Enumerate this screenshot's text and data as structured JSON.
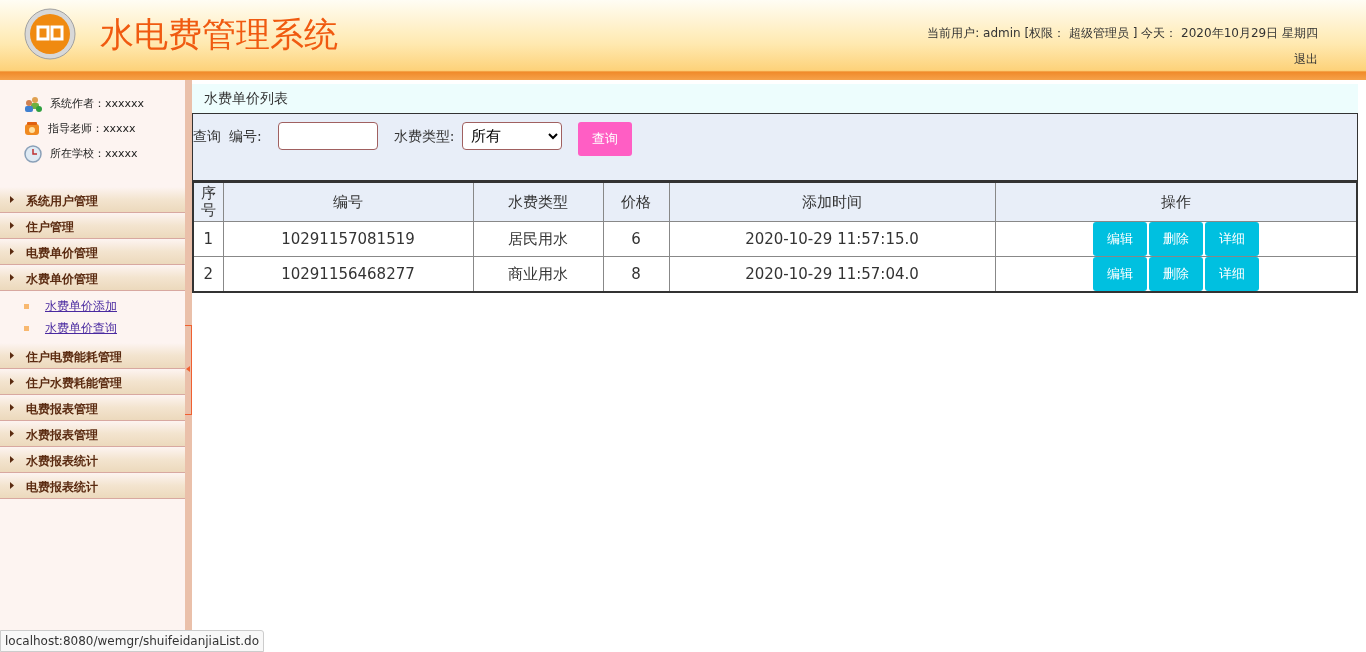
{
  "header": {
    "title": "水电费管理系统",
    "user_info": "当前用户: admin [权限： 超级管理员 ] 今天： 2020年10月29日 星期四",
    "logout": "退出"
  },
  "sidebar": {
    "info": [
      {
        "kind": "author",
        "text": "系统作者：xxxxxx"
      },
      {
        "kind": "teacher",
        "text": "指导老师：xxxxx"
      },
      {
        "kind": "school",
        "text": "所在学校：xxxxx"
      }
    ],
    "items": [
      {
        "label": "系统用户管理"
      },
      {
        "label": "住户管理"
      },
      {
        "label": "电费单价管理"
      },
      {
        "label": "水费单价管理",
        "children": [
          {
            "label": "水费单价添加"
          },
          {
            "label": "水费单价查询"
          }
        ]
      },
      {
        "label": "住户电费能耗管理"
      },
      {
        "label": "住户水费耗能管理"
      },
      {
        "label": "电费报表管理"
      },
      {
        "label": "水费报表管理"
      },
      {
        "label": "水费报表统计"
      },
      {
        "label": "电费报表统计"
      }
    ]
  },
  "main": {
    "title": "水费单价列表",
    "search": {
      "prefix": "查询",
      "id_label": "编号:",
      "type_label": "水费类型:",
      "type_value": "所有",
      "button": "查询"
    },
    "table": {
      "columns": [
        "序号",
        "编号",
        "水费类型",
        "价格",
        "添加时间",
        "操作"
      ],
      "rows": [
        {
          "cells": [
            "1",
            "10291157081519",
            "居民用水",
            "6",
            "2020-10-29 11:57:15.0"
          ],
          "actions": [
            "编辑",
            "删除",
            "详细"
          ]
        },
        {
          "cells": [
            "2",
            "10291156468277",
            "商业用水",
            "8",
            "2020-10-29 11:57:04.0"
          ],
          "actions": [
            "编辑",
            "删除",
            "详细"
          ]
        }
      ]
    }
  },
  "status_bar": "localhost:8080/wemgr/shuifeidanjiaList.do"
}
